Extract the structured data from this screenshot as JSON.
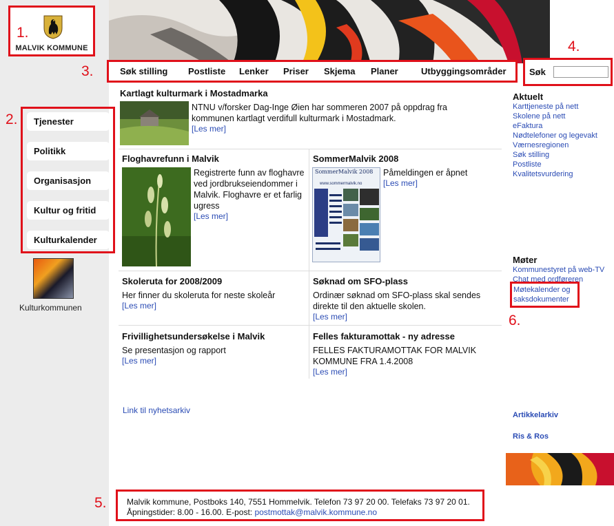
{
  "header": {
    "logo_text": "MALVIK KOMMUNE"
  },
  "annotations": [
    "1.",
    "2.",
    "3.",
    "4.",
    "5.",
    "6."
  ],
  "top_menu": [
    "Søk stilling",
    "Postliste",
    "Lenker",
    "Priser",
    "Skjema",
    "Planer",
    "Utbyggingsområder"
  ],
  "search": {
    "label": "Søk",
    "value": ""
  },
  "sidebar": {
    "items": [
      "Tjenester",
      "Politikk",
      "Organisasjon",
      "Kultur og fritid",
      "Kulturkalender"
    ],
    "kultur_label": "Kulturkommunen"
  },
  "news": {
    "lead": {
      "title": "Kartlagt kulturmark i Mostadmarka",
      "text_lines": [
        "NTNU v/forsker Dag-Inge Øien har sommeren 2007 på oppdrag fra",
        "kommunen kartlagt verdifull kulturmark i Mostadmark."
      ],
      "more": "[Les mer]"
    },
    "floghavre": {
      "title": "Floghavrefunn i Malvik",
      "text_lines": [
        "Registrerte funn av floghavre",
        "ved jordbrukseiendommer i",
        "Malvik. Floghavre er et farlig",
        "ugress"
      ],
      "more": "[Les mer]"
    },
    "sommer": {
      "title": "SommerMalvik 2008",
      "text_lines": [
        "Påmeldingen er åpnet"
      ],
      "more": "[Les mer]",
      "poster_title": "SommerMalvik 2008",
      "poster_url": "www.sommermalvik.no"
    },
    "skoleruta": {
      "title": "Skoleruta for 2008/2009",
      "text_lines": [
        "Her finner du skoleruta for neste skoleår"
      ],
      "more": "[Les mer]"
    },
    "sfo": {
      "title": "Søknad om SFO-plass",
      "text_lines": [
        "Ordinær søknad om SFO-plass skal sendes",
        "direkte til den aktuelle skolen."
      ],
      "more": "[Les mer]"
    },
    "frivillighet": {
      "title": "Frivillighetsundersøkelse i Malvik",
      "text_lines": [
        "Se presentasjon og rapport"
      ],
      "more": "[Les mer]"
    },
    "faktura": {
      "title": "Felles fakturamottak - ny adresse",
      "text_lines": [
        "FELLES FAKTURAMOTTAK FOR MALVIK",
        "KOMMUNE FRA 1.4.2008"
      ],
      "more": "[Les mer]"
    },
    "archive_link": "Link til nyhetsarkiv"
  },
  "right": {
    "aktuelt_heading": "Aktuelt",
    "aktuelt_links": [
      "Karttjeneste på nett",
      "Skolene på nett",
      "eFaktura",
      "Nødtelefoner og legevakt",
      "Værnesregionen",
      "Søk stilling",
      "Postliste",
      "Kvalitetsvurdering"
    ],
    "moter_heading": "Møter",
    "moter_links": [
      "Kommunestyret på web-TV",
      "Chat med ordføreren"
    ],
    "moter_boxed_lines": [
      "Møtekalender og",
      "saksdokumenter"
    ],
    "artikkelarkiv": "Artikkelarkiv",
    "ris_ros": "Ris & Ros"
  },
  "footer": {
    "line1": "Malvik kommune, Postboks 140, 7551 Hommelvik. Telefon 73 97 20 00. Telefaks 73 97 20 01.",
    "line2_prefix": "Åpningstider: 8.00 - 16.00. E-post:",
    "email": "postmottak@malvik.kommune.no"
  },
  "colors": {
    "annotation_red": "#e0101a",
    "link_blue": "#2a4bb4",
    "sidebar_bg": "#ececec"
  }
}
